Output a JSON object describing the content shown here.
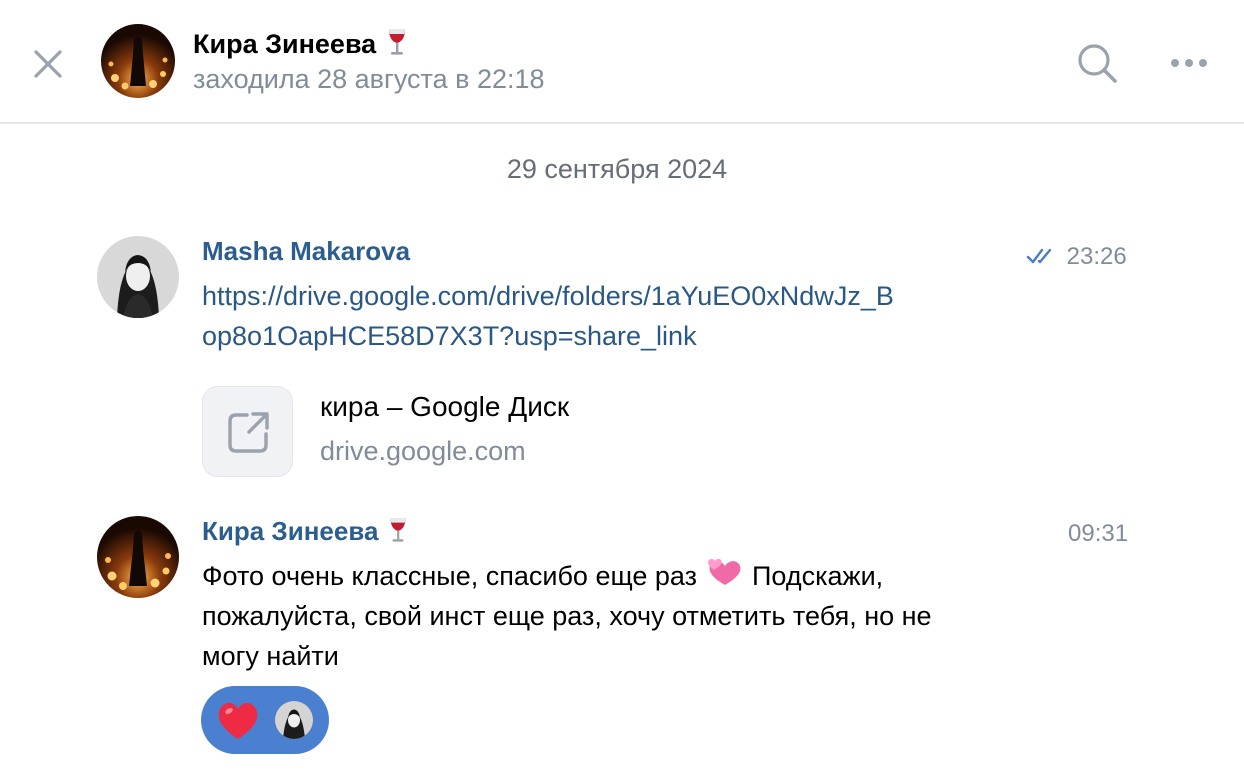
{
  "header": {
    "contact_name": "Кира Зинеева",
    "status": "заходила 28 августа в 22:18"
  },
  "date_separator": "29 сентября 2024",
  "messages": [
    {
      "author": "Masha Makarova",
      "time": "23:26",
      "read": true,
      "link_line1": "https://drive.google.com/drive/folders/1aYuEO0xNdwJz_B",
      "link_line2": "op8o1OapHCE58D7X3T?usp=share_link",
      "snippet": {
        "title": "кира – Google Диск",
        "domain": "drive.google.com"
      }
    },
    {
      "author": "Кира Зинеева",
      "time": "09:31",
      "line1_a": "Фото очень классные, спасибо еще раз",
      "line1_b": " Подскажи,",
      "line2": "пожалуйста, свой инст еще раз, хочу отметить тебя, но не",
      "line3": "могу найти",
      "reaction": "heart"
    }
  ],
  "colors": {
    "author": "#2c5d8f",
    "link": "#2a5885",
    "secondary": "#818c99",
    "reaction_bg": "#4b7fd0"
  }
}
